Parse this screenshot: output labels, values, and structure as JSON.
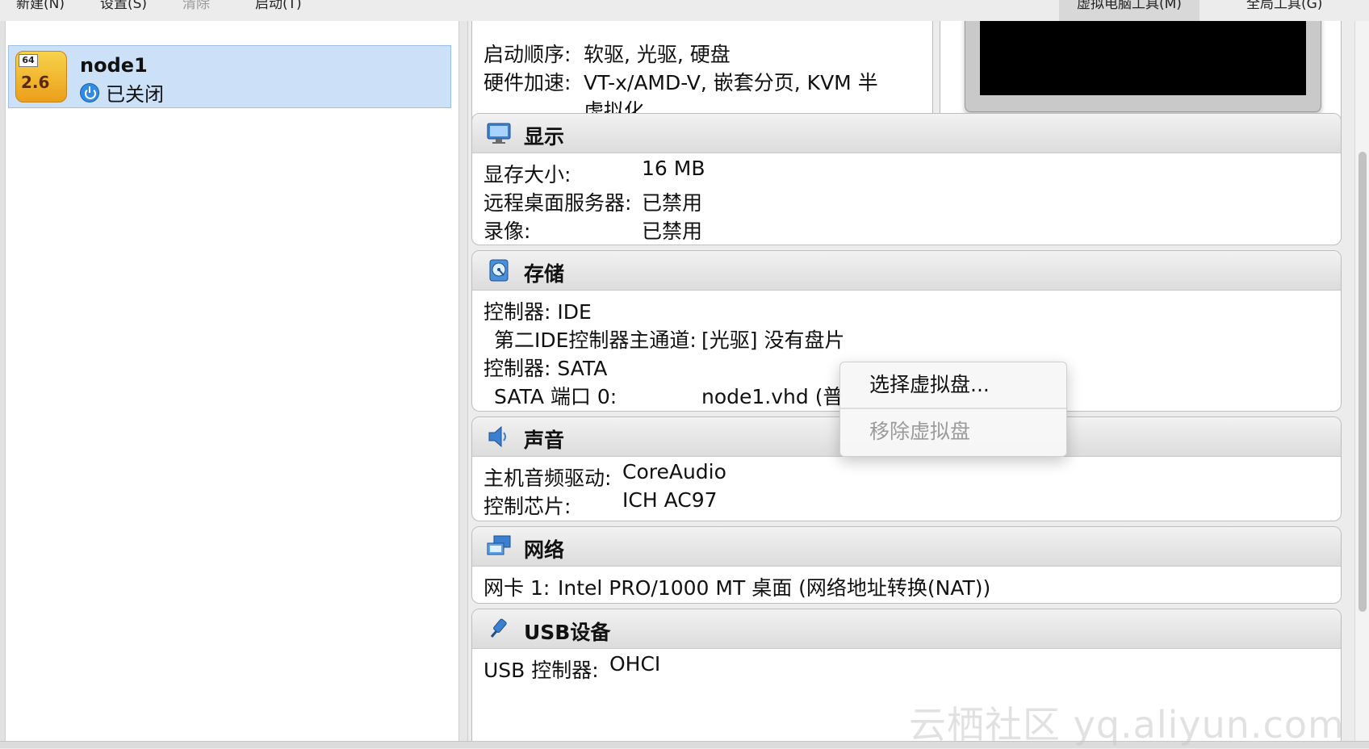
{
  "toolbar": {
    "new_label": "新建(N)",
    "settings_label": "设置(S)",
    "discard_label": "清除",
    "start_label": "启动(T)",
    "machine_tools_label": "虚拟电脑工具(M)",
    "global_tools_label": "全局工具(G)"
  },
  "vm": {
    "name": "node1",
    "state": "已关闭",
    "badge": "64",
    "version": "2.6"
  },
  "general": {
    "boot_order_label": "启动顺序:",
    "boot_order_value": "软驱, 光驱, 硬盘",
    "acceleration_label": "硬件加速:",
    "acceleration_value_line1": "VT-x/AMD-V, 嵌套分页, KVM 半",
    "acceleration_value_line2": "虚拟化"
  },
  "display": {
    "title": "显示",
    "video_memory_label": "显存大小:",
    "video_memory_value": "16 MB",
    "remote_desktop_label": "远程桌面服务器:",
    "remote_desktop_value": "已禁用",
    "recording_label": "录像:",
    "recording_value": "已禁用"
  },
  "storage": {
    "title": "存储",
    "controller_ide": "控制器: IDE",
    "ide_secondary_master_label": "第二IDE控制器主通道:",
    "ide_secondary_master_value": "[光驱] 没有盘片",
    "controller_sata": "控制器: SATA",
    "sata_port0_label": "SATA 端口 0:",
    "sata_port0_value": "node1.vhd (普"
  },
  "audio": {
    "title": "声音",
    "host_driver_label": "主机音频驱动:",
    "host_driver_value": "CoreAudio",
    "controller_label": "控制芯片:",
    "controller_value": "ICH AC97"
  },
  "network": {
    "title": "网络",
    "adapter1_label": "网卡 1:",
    "adapter1_value": "Intel PRO/1000 MT 桌面 (网络地址转换(NAT))"
  },
  "usb": {
    "title": "USB设备",
    "controller_label": "USB 控制器:",
    "controller_value": "OHCI"
  },
  "context_menu": {
    "choose_disk": "选择虚拟盘...",
    "remove_disk": "移除虚拟盘"
  },
  "watermark": "云栖社区 yq.aliyun.com",
  "colors": {
    "selection": "#cce1f7",
    "vm_icon": "#f2b531",
    "power_icon": "#2f8be3"
  }
}
